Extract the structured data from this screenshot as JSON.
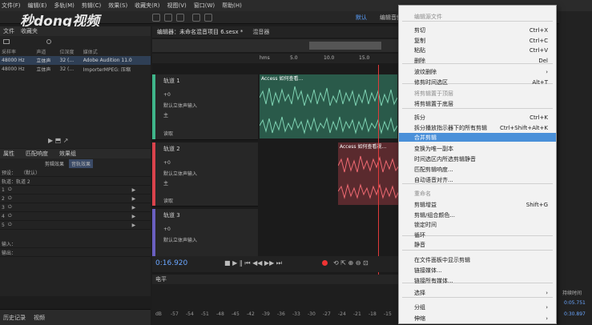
{
  "menubar": [
    "文件(F)",
    "编辑(E)",
    "多轨(M)",
    "剪辑(C)",
    "效果(S)",
    "收藏夹(R)",
    "视图(V)",
    "窗口(W)",
    "帮助(H)"
  ],
  "workspace": {
    "default": "默认",
    "edit": "编辑音频"
  },
  "watermark": "秒dong视频",
  "files_panel": {
    "tab1": "文件",
    "tab2": "收藏夹",
    "headers": [
      "采样率",
      "声道",
      "位深度",
      "媒体式"
    ],
    "rows": [
      [
        "48000 Hz",
        "立体声",
        "32 (...",
        "Adobe Audition 11.0"
      ],
      [
        "48000 Hz",
        "立体声",
        "32 (...",
        "ImporterMPEG: 压缩"
      ]
    ]
  },
  "fx_panel": {
    "tabs": [
      "属性",
      "匹配响度",
      "效果组"
    ],
    "subtabs": [
      "剪辑效果",
      "音轨效果"
    ],
    "preset_label": "预设：",
    "preset_value": "（默认）",
    "track": "轨道：轨道 2",
    "slots": [
      "1",
      "2",
      "3",
      "4",
      "5"
    ],
    "in": "输入：",
    "out": "输出："
  },
  "history_panel": {
    "tab1": "历史记录",
    "tab2": "视频"
  },
  "editor": {
    "tab1": "编辑器：未命名混音项目 6.sesx *",
    "tab2": "混音器",
    "ruler": [
      "hms",
      "5.0",
      "10.0",
      "15.0"
    ],
    "tracks": [
      {
        "name": "轨道 1",
        "vol": "+0",
        "input": "默认立体声输入",
        "bus": "主",
        "mode": "读取"
      },
      {
        "name": "轨道 2",
        "vol": "+0",
        "input": "默认立体声输入",
        "bus": "主",
        "mode": "读取"
      },
      {
        "name": "轨道 3",
        "vol": "+0",
        "input": "默认立体声输入"
      }
    ],
    "clip_label": "Access 如何查看…",
    "clip_label2": "Access 如何查看视…"
  },
  "transport": {
    "time": "0:16.920"
  },
  "level": {
    "label": "电平",
    "scale": [
      "dB",
      "-57",
      "-54",
      "-51",
      "-48",
      "-45",
      "-42",
      "-39",
      "-36",
      "-33",
      "-30",
      "-27",
      "-24",
      "-21",
      "-18",
      "-15"
    ]
  },
  "right_panel": {
    "label": "持续时间",
    "t1": "0:05.751",
    "t2": "0:30.897"
  },
  "context_menu": {
    "items": [
      {
        "label": "编辑源文件",
        "shortcut": "",
        "dis": true
      },
      {
        "label": "剪切",
        "shortcut": "Ctrl+X"
      },
      {
        "label": "复制",
        "shortcut": "Ctrl+C"
      },
      {
        "label": "粘贴",
        "shortcut": "Ctrl+V"
      },
      {
        "label": "删除",
        "shortcut": "Del"
      },
      {
        "label": "波纹删除",
        "shortcut": "",
        "sub": true
      },
      {
        "label": "修剪时间选区",
        "shortcut": "Alt+T"
      },
      {
        "label": "将剪辑置于顶层",
        "shortcut": "",
        "dis": true
      },
      {
        "label": "将剪辑置于底层",
        "shortcut": ""
      },
      {
        "label": "拆分",
        "shortcut": "Ctrl+K"
      },
      {
        "label": "拆分播放指示器下的所有剪辑",
        "shortcut": "Ctrl+Shift+Alt+K"
      },
      {
        "label": "合并剪辑",
        "shortcut": "",
        "hl": true
      },
      {
        "label": "变换为唯一副本",
        "shortcut": ""
      },
      {
        "label": "时间选区内所选剪辑静音",
        "shortcut": ""
      },
      {
        "label": "匹配剪辑响度...",
        "shortcut": ""
      },
      {
        "label": "自动语音对齐...",
        "shortcut": ""
      },
      {
        "label": "重命名",
        "shortcut": "",
        "dis": true
      },
      {
        "label": "剪辑增益",
        "shortcut": "Shift+G"
      },
      {
        "label": "剪辑/组合颜色...",
        "shortcut": ""
      },
      {
        "label": "锁定时间",
        "shortcut": ""
      },
      {
        "label": "循环",
        "shortcut": ""
      },
      {
        "label": "静音",
        "shortcut": ""
      },
      {
        "label": "在文件面板中显示剪辑",
        "shortcut": ""
      },
      {
        "label": "链接媒体...",
        "shortcut": ""
      },
      {
        "label": "链接所有媒体...",
        "shortcut": ""
      },
      {
        "label": "选择",
        "shortcut": "",
        "sub": true
      },
      {
        "label": "分组",
        "shortcut": "",
        "sub": true
      },
      {
        "label": "伸缩",
        "shortcut": "",
        "sub": true
      }
    ]
  }
}
